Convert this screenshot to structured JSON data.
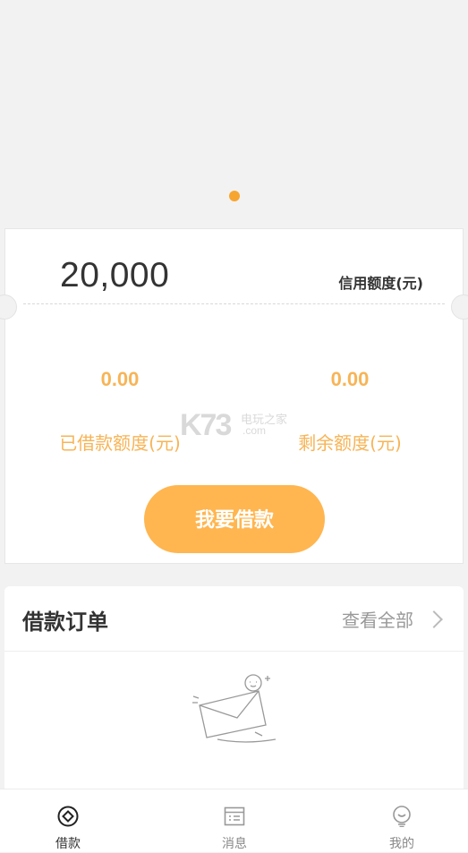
{
  "banner": {
    "dots": 1,
    "active_dot": 1
  },
  "credit": {
    "amount": "20,000",
    "label": "信用额度(元)",
    "borrowed_value": "0.00",
    "borrowed_label": "已借款额度(元)",
    "remaining_value": "0.00",
    "remaining_label": "剩余额度(元)",
    "borrow_button": "我要借款"
  },
  "watermark": {
    "text": "K73",
    "site": "电玩之家",
    "domain": ".com"
  },
  "orders": {
    "title": "借款订单",
    "view_all": "查看全部"
  },
  "tabbar": {
    "tabs": [
      {
        "label": "借款",
        "icon": "diamond-circle-icon",
        "active": true
      },
      {
        "label": "消息",
        "icon": "message-list-icon",
        "active": false
      },
      {
        "label": "我的",
        "icon": "lightbulb-icon",
        "active": false
      }
    ]
  },
  "colors": {
    "accent": "#ffb650",
    "accent_text": "#f7b456",
    "dot": "#f7a531"
  }
}
